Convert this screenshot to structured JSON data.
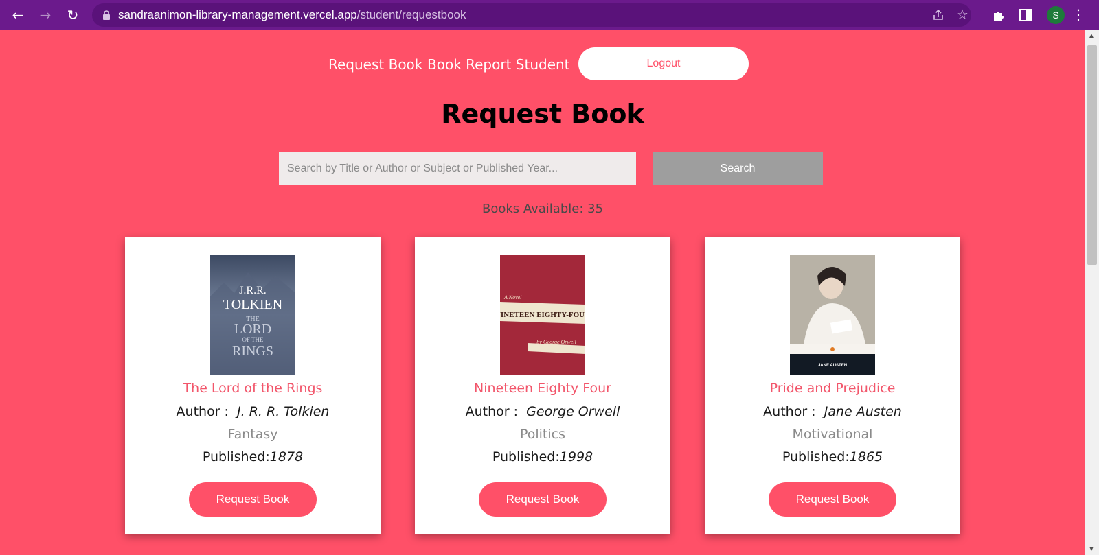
{
  "browser": {
    "url_host": "sandraanimon-library-management.vercel.app",
    "url_path": "/student/requestbook",
    "profile_initial": "S"
  },
  "nav": {
    "request_book": "Request Book",
    "book_report": "Book Report Student",
    "logout": "Logout"
  },
  "page_title": "Request Book",
  "search": {
    "placeholder": "Search by Title or Author or Subject or Published Year...",
    "button": "Search"
  },
  "books_available": "Books Available: 35",
  "books": [
    {
      "title": "The Lord of the Rings",
      "author_label": "Author :",
      "author": "J. R. R. Tolkien",
      "genre": "Fantasy",
      "published_label": "Published:",
      "published": "1878",
      "button": "Request Book",
      "cover_text": [
        "J.R.R.",
        "TOLKIEN",
        "THE",
        "LORD",
        "OF THE",
        "RINGS"
      ]
    },
    {
      "title": "Nineteen Eighty Four",
      "author_label": "Author :",
      "author": "George Orwell",
      "genre": "Politics",
      "published_label": "Published:",
      "published": "1998",
      "button": "Request Book",
      "cover_text": [
        "A Novel",
        "NINETEEN EIGHTY-FOUR",
        "by George Orwell"
      ]
    },
    {
      "title": "Pride and Prejudice",
      "author_label": "Author :",
      "author": "Jane Austen",
      "genre": "Motivational",
      "published_label": "Published:",
      "published": "1865",
      "button": "Request Book",
      "cover_text": [
        "JANE AUSTEN"
      ]
    }
  ],
  "colors": {
    "background": "#ff5068",
    "browser_bar": "#6b1a8c",
    "accent_text": "#f2566b",
    "search_button": "#9e9e9e"
  }
}
